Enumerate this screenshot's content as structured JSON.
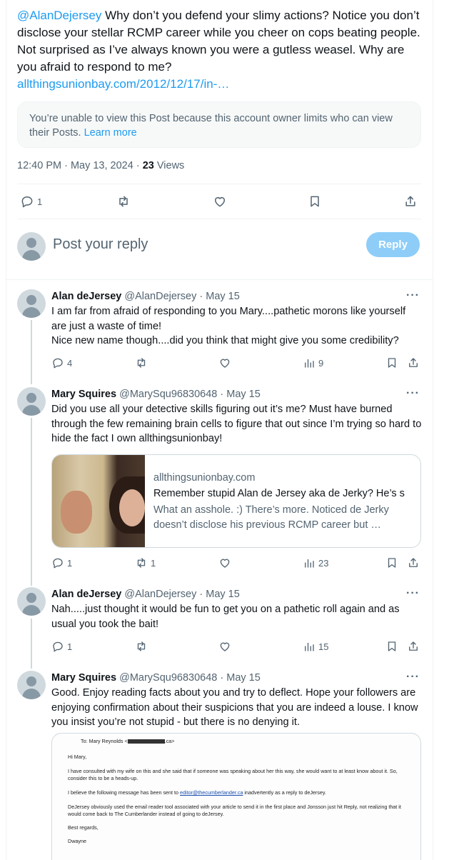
{
  "main_tweet": {
    "mention": "@AlanDejersey",
    "text": " Why don’t you defend your slimy actions?  Notice you don’t disclose your stellar RCMP career while you cheer on cops beating people. Not surprised as I’ve always known you were a gutless weasel. Why are you afraid to respond to me?",
    "link": "allthingsunionbay.com/2012/12/17/in-…",
    "notice_text": "You’re unable to view this Post because this account owner limits who can view their Posts.",
    "notice_link": "Learn more",
    "time": "12:40 PM · May 13, 2024 · ",
    "views_count": "23",
    "views_label": " Views",
    "actions": {
      "reply_count": "1",
      "icons": [
        "reply-icon",
        "retweet-icon",
        "like-icon",
        "bookmark-icon",
        "share-icon"
      ]
    }
  },
  "composer": {
    "placeholder": "Post your reply",
    "button_label": "Reply",
    "button_color": "#8ecdf8"
  },
  "replies": [
    {
      "name": "Alan deJersey",
      "handle": "@AlanDejersey",
      "date": "May 15",
      "text": "I am far from afraid of responding to you Mary....pathetic morons like yourself are just a waste of time!\nNice new name though....did you think that might give you some credibility?",
      "reply_count": "4",
      "retweet_count": "",
      "views": "9"
    },
    {
      "name": "Mary Squires",
      "handle": "@MarySqu96830648",
      "date": "May 15",
      "text": "Did you use all your detective skills figuring out it’s me?  Must have burned through the few remaining brain cells to figure that out since I’m trying so hard to hide the fact I own allthingsunionbay!",
      "card": {
        "domain": "allthingsunionbay.com",
        "title": "Remember stupid Alan de Jersey aka de Jerky? He’s s",
        "description": "What an asshole. :) There’s more. Noticed de Jerky doesn’t disclose his previous RCMP career but …"
      },
      "reply_count": "1",
      "retweet_count": "1",
      "views": "23"
    },
    {
      "name": "Alan deJersey",
      "handle": "@AlanDejersey",
      "date": "May 15",
      "text": "Nah.....just thought it would be fun to get you on a pathetic roll again and as usual you took the bait!",
      "reply_count": "1",
      "retweet_count": "",
      "views": "15"
    },
    {
      "name": "Mary Squires",
      "handle": "@MarySqu96830648",
      "date": "May 15",
      "text": "Good. Enjoy reading facts about you and try to deflect. Hope your followers are enjoying confirmation about their suspicions that you are indeed a louse. I know you insist you’re not stupid - but there is no denying it.",
      "document": {
        "to_line": "To: Mary Reynolds <",
        "greeting": "Hi Mary,",
        "p1": "I have consulted with my wife on this and she said that if someone was speaking about her this way, she would want to at least know about it. So, consider this to be a heads-up.",
        "p2_pre": "I believe the following message has been sent to ",
        "p2_email": "editor@thecumberlander.ca",
        "p2_post": " inadvertently as a reply to deJersey.",
        "p3": "DeJersey obviously used the email reader tool associated with your article to send it in the first place and Jonsson just hit Reply, not realizing that it would come back to The Cumberlander instead of going to deJersey.",
        "closing": "Best regards,",
        "signature": "Dwayne"
      }
    }
  ],
  "more_label": "···",
  "separator": " · "
}
